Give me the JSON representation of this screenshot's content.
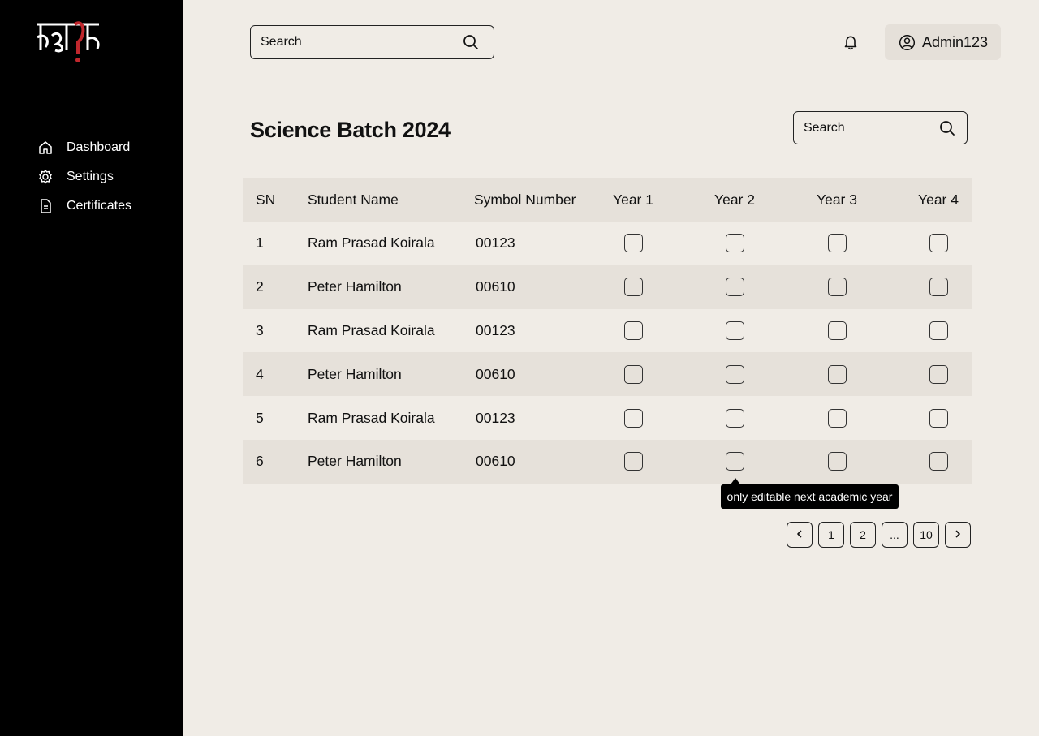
{
  "brand": {
    "logo_text": "दिक्षांत",
    "accent_color": "#c0272d"
  },
  "sidebar": {
    "items": [
      {
        "label": "Dashboard",
        "icon": "home-icon"
      },
      {
        "label": "Settings",
        "icon": "gear-icon"
      },
      {
        "label": "Certificates",
        "icon": "document-icon"
      }
    ]
  },
  "header": {
    "search_placeholder": "Search",
    "user_label": "Admin123"
  },
  "main": {
    "title": "Science Batch 2024",
    "search_placeholder": "Search",
    "table": {
      "columns": [
        "SN",
        "Student Name",
        "Symbol Number",
        "Year 1",
        "Year 2",
        "Year 3",
        "Year 4"
      ],
      "rows": [
        {
          "sn": "1",
          "name": "Ram Prasad Koirala",
          "symbol": "00123",
          "years": [
            false,
            false,
            false,
            false
          ]
        },
        {
          "sn": "2",
          "name": "Peter Hamilton",
          "symbol": "00610",
          "years": [
            false,
            false,
            false,
            false
          ]
        },
        {
          "sn": "3",
          "name": "Ram Prasad Koirala",
          "symbol": "00123",
          "years": [
            false,
            false,
            false,
            false
          ]
        },
        {
          "sn": "4",
          "name": "Peter Hamilton",
          "symbol": "00610",
          "years": [
            false,
            false,
            false,
            false
          ]
        },
        {
          "sn": "5",
          "name": "Ram Prasad Koirala",
          "symbol": "00123",
          "years": [
            false,
            false,
            false,
            false
          ]
        },
        {
          "sn": "6",
          "name": "Peter Hamilton",
          "symbol": "00610",
          "years": [
            false,
            false,
            false,
            false
          ]
        }
      ]
    },
    "tooltip": "only editable next academic year",
    "pagination": {
      "prev_icon": "chevron-left-icon",
      "pages": [
        "1",
        "2",
        "...",
        "10"
      ],
      "next_icon": "chevron-right-icon"
    }
  }
}
